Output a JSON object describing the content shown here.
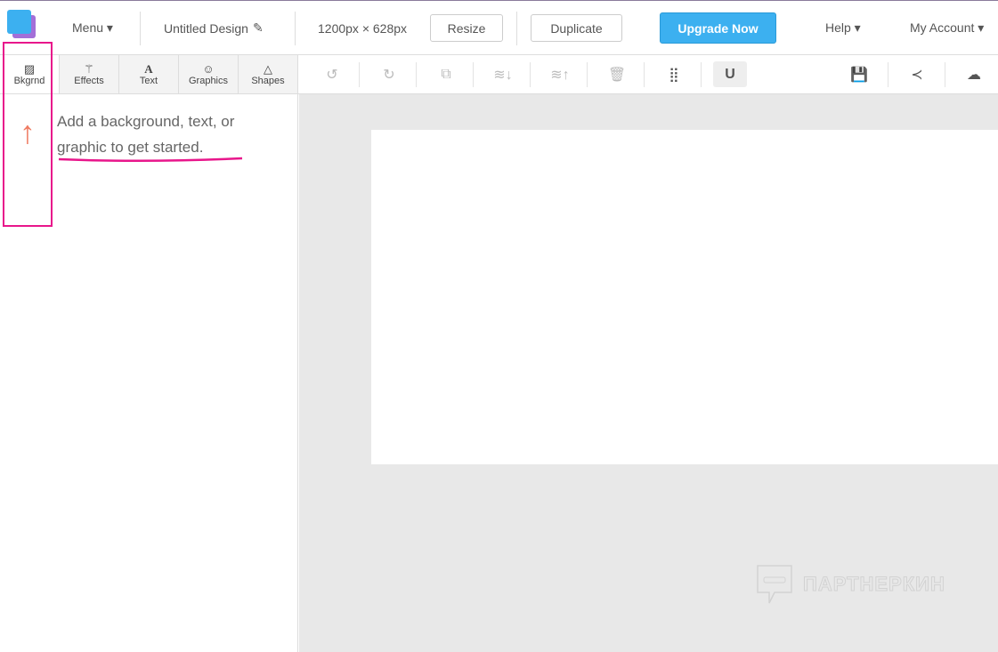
{
  "header": {
    "menu": "Menu ▾",
    "title": "Untitled Design",
    "size": "1200px × 628px",
    "resize": "Resize",
    "duplicate": "Duplicate",
    "upgrade": "Upgrade Now",
    "help": "Help ▾",
    "account": "My Account ▾"
  },
  "tabs": [
    {
      "label": "Bkgrnd",
      "icon": "🖼"
    },
    {
      "label": "Effects",
      "icon": "✨"
    },
    {
      "label": "Text",
      "icon": "A"
    },
    {
      "label": "Graphics",
      "icon": "☺"
    },
    {
      "label": "Shapes",
      "icon": "△"
    }
  ],
  "panel": {
    "message": "Add a background, text, or graphic to get started."
  },
  "watermark": "ПАРТНЕРКИН",
  "colors": {
    "accent": "#3cb0f0",
    "highlight": "#e8168b",
    "arrow": "#ef7b62"
  }
}
